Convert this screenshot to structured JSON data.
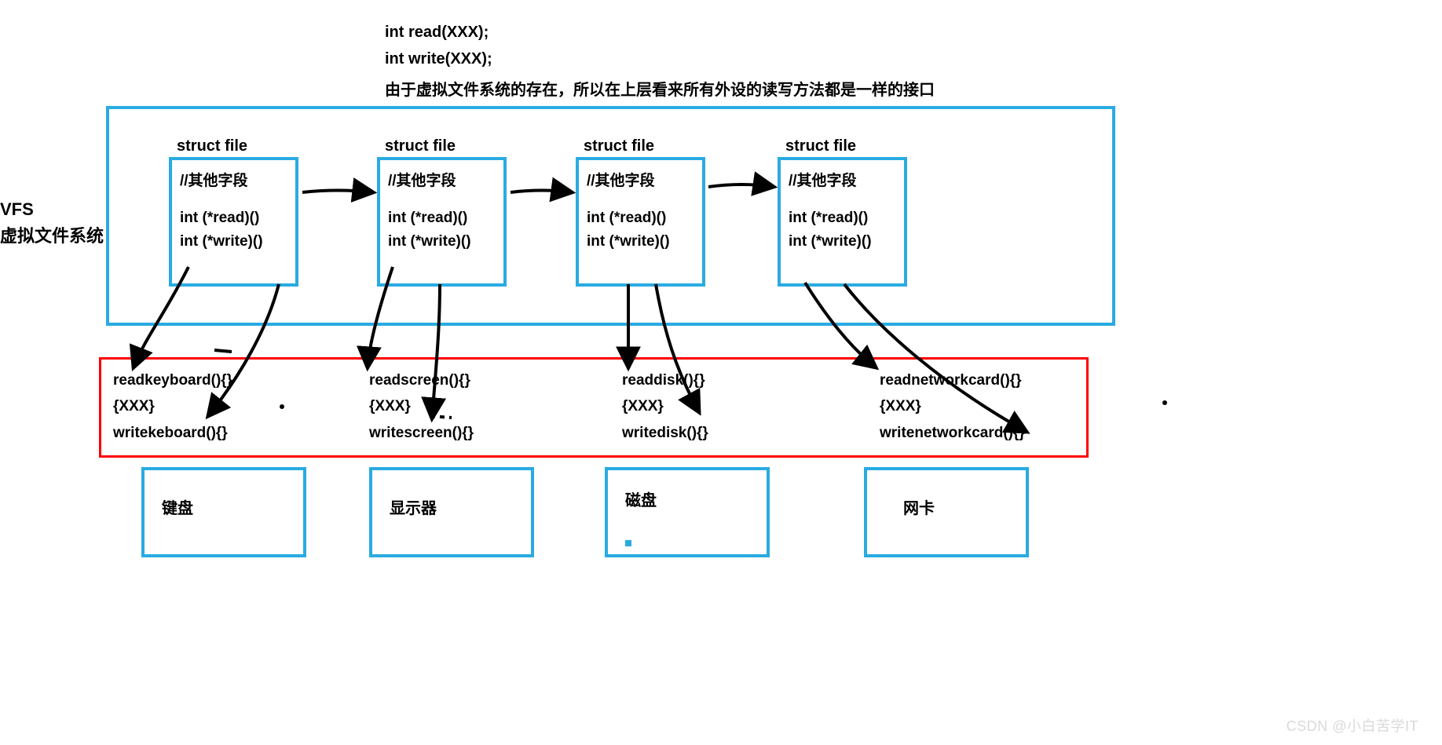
{
  "header": {
    "line1": "int read(XXX);",
    "line2": "int write(XXX);",
    "line3": "由于虚拟文件系统的存在，所以在上层看来所有外设的读写方法都是一样的接口"
  },
  "vfs": {
    "line1": "VFS",
    "line2": "虚拟文件系统"
  },
  "struct": {
    "title": "struct file",
    "l1": "//其他字段",
    "l2": "int (*read)()",
    "l3": "int (*write)()"
  },
  "drivers": {
    "kb": {
      "read": "readkeyboard(){}",
      "body": "{XXX}",
      "write": "writekeboard(){}"
    },
    "scr": {
      "read": "readscreen(){}",
      "body": "{XXX}",
      "write": "writescreen(){}"
    },
    "disk": {
      "read": "readdisk(){}",
      "body": "{XXX}",
      "write": "writedisk(){}"
    },
    "net": {
      "read": "readnetworkcard(){}",
      "body": "{XXX}",
      "write": "writenetworkcard(){}"
    }
  },
  "devices": {
    "kb": "键盘",
    "scr": "显示器",
    "disk": "磁盘",
    "net": "网卡"
  },
  "watermark": "CSDN @小白苦学IT"
}
